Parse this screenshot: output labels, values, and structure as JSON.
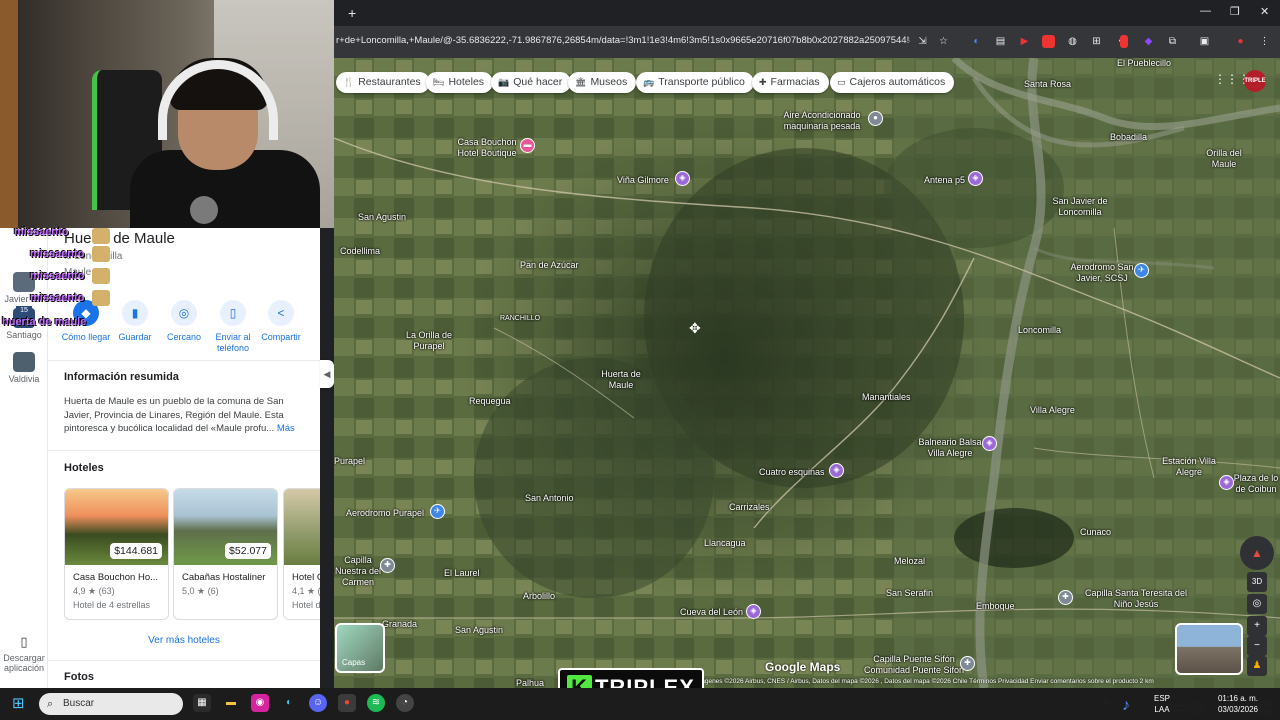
{
  "browser": {
    "url": "r+de+Loncomilla,+Maule/@-35.6836222,-71.9867876,26854m/data=!3m1!1e3!4m6!3m5!1s0x9665e20716f07b8b0x2027882a25097544!8...",
    "new_tab": "+",
    "window_controls": [
      "—",
      "❐",
      "✕"
    ]
  },
  "chat_overlay": {
    "lines": [
      "missaento",
      "missaento",
      "missaento",
      "missaento",
      "huerta de maule"
    ],
    "badge": "15"
  },
  "rail": {
    "items": [
      {
        "label": "Javier d..."
      },
      {
        "label": "Santiago"
      },
      {
        "label": "Valdivia"
      },
      {
        "label": "Descargar aplicación"
      }
    ]
  },
  "place": {
    "title": "Huerta de Maule",
    "subtitle": "le Loncomilla",
    "subtitle2": "Maule",
    "actions": [
      {
        "label": "Cómo llegar",
        "icon": "directions-icon"
      },
      {
        "label": "Guardar",
        "icon": "bookmark-icon"
      },
      {
        "label": "Cercano",
        "icon": "nearby-icon"
      },
      {
        "label": "Enviar al teléfono",
        "icon": "phone-icon"
      },
      {
        "label": "Compartir",
        "icon": "share-icon"
      }
    ],
    "summary_title": "Información resumida",
    "summary_text": "Huerta de Maule es un pueblo de la comuna de San Javier, Provincia de Linares, Región del Maule. Esta pintoresca y bucólica localidad del «Maule profu...",
    "summary_more": "Más",
    "hotels_title": "Hoteles",
    "hotels": [
      {
        "name": "Casa Bouchon Ho...",
        "price": "$144.681",
        "rating": "4,9 ★ (63)",
        "stars": "Hotel de 4 estrellas"
      },
      {
        "name": "Cabañas Hostaliner",
        "price": "$52.077",
        "rating": "5,0 ★ (6)",
        "stars": ""
      },
      {
        "name": "Hotel C",
        "price": "",
        "rating": "4,1 ★ (",
        "stars": "Hotel d"
      }
    ],
    "more_hotels": "Ver más hoteles",
    "photos_title": "Fotos"
  },
  "map": {
    "chips": [
      {
        "label": "Restaurantes",
        "icon": "🍴"
      },
      {
        "label": "Hoteles",
        "icon": "🛏"
      },
      {
        "label": "Qué hacer",
        "icon": "📷"
      },
      {
        "label": "Museos",
        "icon": "🏛"
      },
      {
        "label": "Transporte público",
        "icon": "🚌"
      },
      {
        "label": "Farmacias",
        "icon": "✚"
      },
      {
        "label": "Cajeros automáticos",
        "icon": "▭"
      }
    ],
    "labels": [
      {
        "text": "El Pueblecillo"
      },
      {
        "text": "Santa Rosa"
      },
      {
        "text": "Aire Acondicionado maquinaria pesada"
      },
      {
        "text": "Bobadilla"
      },
      {
        "text": "Orilla del Maule"
      },
      {
        "text": "Casa Bouchon Hotel Boutique"
      },
      {
        "text": "Viña Gilmore"
      },
      {
        "text": "Antena p5"
      },
      {
        "text": "San Javier de Loncomilla"
      },
      {
        "text": "San Agustin"
      },
      {
        "text": "Codellima"
      },
      {
        "text": "Pan de Azúcar"
      },
      {
        "text": "Aerodromo San Javier, SCSJ"
      },
      {
        "text": "RANCHILLO"
      },
      {
        "text": "La Orilla de Purapel"
      },
      {
        "text": "Loncomilla"
      },
      {
        "text": "Huerta de Maule"
      },
      {
        "text": "Requegua"
      },
      {
        "text": "Manantiales"
      },
      {
        "text": "Villa Alegre"
      },
      {
        "text": "Balneario Balsa Villa Alegre"
      },
      {
        "text": "Estación Villa Alegre"
      },
      {
        "text": "Purapel"
      },
      {
        "text": "Plaza de lo de Coibun"
      },
      {
        "text": "Cuatro esquinas"
      },
      {
        "text": "San Antonio"
      },
      {
        "text": "Carrizales"
      },
      {
        "text": "Aerodromo Purapel"
      },
      {
        "text": "Cunaco"
      },
      {
        "text": "Llancagua"
      },
      {
        "text": "Capilla Nuestra del Carmen"
      },
      {
        "text": "El Laurel"
      },
      {
        "text": "Melozal"
      },
      {
        "text": "San Serafin"
      },
      {
        "text": "Emboque"
      },
      {
        "text": "Capilla Santa Teresita del Niño Jesús"
      },
      {
        "text": "Arbolillo"
      },
      {
        "text": "Cueva del León"
      },
      {
        "text": "San Agustin"
      },
      {
        "text": "Capilla Puente Sifón Comunidad Puente Sifon"
      },
      {
        "text": "Palhua"
      },
      {
        "text": "Granada"
      }
    ],
    "layers_label": "Capas",
    "logo": "Google Maps",
    "footer": "Imágenes ©2026 Airbus, CNES / Airbus, Datos del mapa ©2026 , Datos del mapa ©2026     Chile     Términos     Privacidad     Enviar comentarios sobre el producto     2 km",
    "view_3d": "3D"
  },
  "stream_logo": {
    "k": "K",
    "text": "TRIPLEX"
  },
  "taskbar": {
    "search_placeholder": "Buscar",
    "lang_top": "ESP",
    "lang_bottom": "LAA",
    "time": "01:16 a. m.",
    "date": "03/03/2026"
  }
}
